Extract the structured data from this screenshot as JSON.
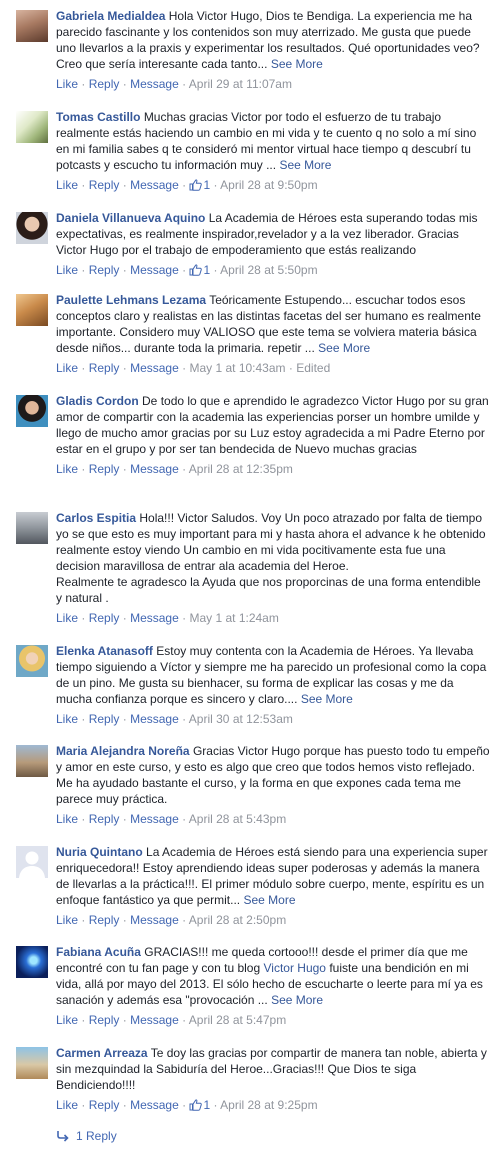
{
  "actions": {
    "like": "Like",
    "reply": "Reply",
    "message": "Message",
    "dot": "·"
  },
  "comments": [
    {
      "name": "Gabriela Medialdea",
      "text": "Hola Victor Hugo, Dios te Bendiga. La experiencia me ha parecido fascinante y los contenidos son muy aterrizado. Me gusta que puede uno llevarlos a la praxis y experimentar los resultados. Qué oportunidades veo? Creo que sería interesante cada tanto...",
      "see_more": "See More",
      "likes": "",
      "time": "April 29 at 11:07am",
      "edited": ""
    },
    {
      "name": "Tomas Castillo",
      "text": "Muchas gracias Victor por todo el esfuerzo de tu trabajo realmente estás haciendo un cambio en mi vida y te cuento q no solo a mí sino en mi familia sabes q te consideró mi mentor virtual hace tiempo q descubrí tu potcasts y escucho tu información muy ...",
      "see_more": "See More",
      "likes": "1",
      "time": "April 28 at 9:50pm",
      "edited": ""
    },
    {
      "name": "Daniela Villanueva Aquino",
      "text": "La Academia de Héroes esta superando todas mis expectativas, es realmente inspirador,revelador y a la vez liberador. Gracias Victor Hugo por el trabajo de empoderamiento que estás realizando",
      "see_more": "",
      "likes": "1",
      "time": "April 28 at 5:50pm",
      "edited": ""
    },
    {
      "name": "Paulette Lehmans Lezama",
      "text": "Teóricamente Estupendo... escuchar todos esos conceptos claro y realistas en las distintas facetas del ser humano es realmente importante. Considero muy VALIOSO que este tema se volviera materia básica desde niños... durante toda la primaria. repetir ...",
      "see_more": "See More",
      "likes": "",
      "time": "May 1 at 10:43am",
      "edited": "Edited"
    },
    {
      "name": "Gladis Cordon",
      "text": "De todo lo que e aprendido le agradezco Victor Hugo por su gran amor de compartir con la academia las experiencias porser un hombre umilde y llego de mucho amor gracias por su Luz estoy agradecida a mi Padre Eterno por estar en el grupo y por ser tan bendecida de Nuevo muchas gracias",
      "see_more": "",
      "likes": "",
      "time": "April 28 at 12:35pm",
      "edited": ""
    },
    {
      "name": "Carlos Espitia",
      "text": "Hola!!! Victor Saludos. Voy Un poco atrazado por falta de tiempo yo se que esto es muy important para mi y hasta ahora el advance k he obtenido realmente estoy viendo Un cambio en mi vida pocitivamente esta fue una decision maravillosa de entrar ala academia del Heroe.",
      "text2": "Realmente te agradesco la Ayuda que nos proporcinas de una forma entendible y natural .",
      "see_more": "",
      "likes": "",
      "time": "May 1 at 1:24am",
      "edited": ""
    },
    {
      "name": "Elenka Atanasoff",
      "text": "Estoy muy contenta con la Academia de Héroes. Ya llevaba tiempo siguiendo a Víctor y siempre me ha parecido un profesional como la copa de un pino. Me gusta su bienhacer, su forma de explicar las cosas y me da mucha confianza porque es sincero y claro....",
      "see_more": "See More",
      "likes": "",
      "time": "April 30 at 12:53am",
      "edited": ""
    },
    {
      "name": "Maria Alejandra Noreña",
      "text": "Gracias Victor Hugo porque has puesto todo tu empeño y amor en este curso, y esto es algo que creo que todos hemos visto reflejado. Me ha ayudado bastante el curso, y la forma en que expones cada tema me parece muy práctica.",
      "see_more": "",
      "likes": "",
      "time": "April 28 at 5:43pm",
      "edited": ""
    },
    {
      "name": "Nuria Quintano",
      "text": "La Academia de Héroes está siendo para una experiencia super enriquecedora!! Estoy aprendiendo ideas super poderosas y además la manera de llevarlas a la práctica!!!. El primer módulo sobre cuerpo, mente, espíritu es un enfoque fantástico ya que permit...",
      "see_more": "See More",
      "likes": "",
      "time": "April 28 at 2:50pm",
      "edited": ""
    },
    {
      "name": "Fabiana Acuña",
      "text_a": "GRACIAS!!! me queda cortooo!!! desde el primer día que me encontré con tu fan page y con tu blog",
      "mention": "Victor Hugo",
      "text_b": "fuiste una bendición en mi vida, allá por mayo del 2013. El sólo hecho de escucharte o leerte para mí ya es sanación y además esa \"provocación ...",
      "see_more": "See More",
      "likes": "",
      "time": "April 28 at 5:47pm",
      "edited": ""
    },
    {
      "name": "Carmen Arreaza",
      "text": "Te doy las gracias por compartir de manera tan noble, abierta y sin mezquindad la Sabiduría del Heroe...Gracias!!! Que Dios te siga Bendiciendo!!!!",
      "see_more": "",
      "likes": "1",
      "time": "April 28 at 9:25pm",
      "edited": ""
    }
  ],
  "replies_link": "1 Reply",
  "colors": {
    "link": "#365899",
    "action": "#4267b2",
    "meta": "#90949c",
    "text": "#1d2129"
  }
}
